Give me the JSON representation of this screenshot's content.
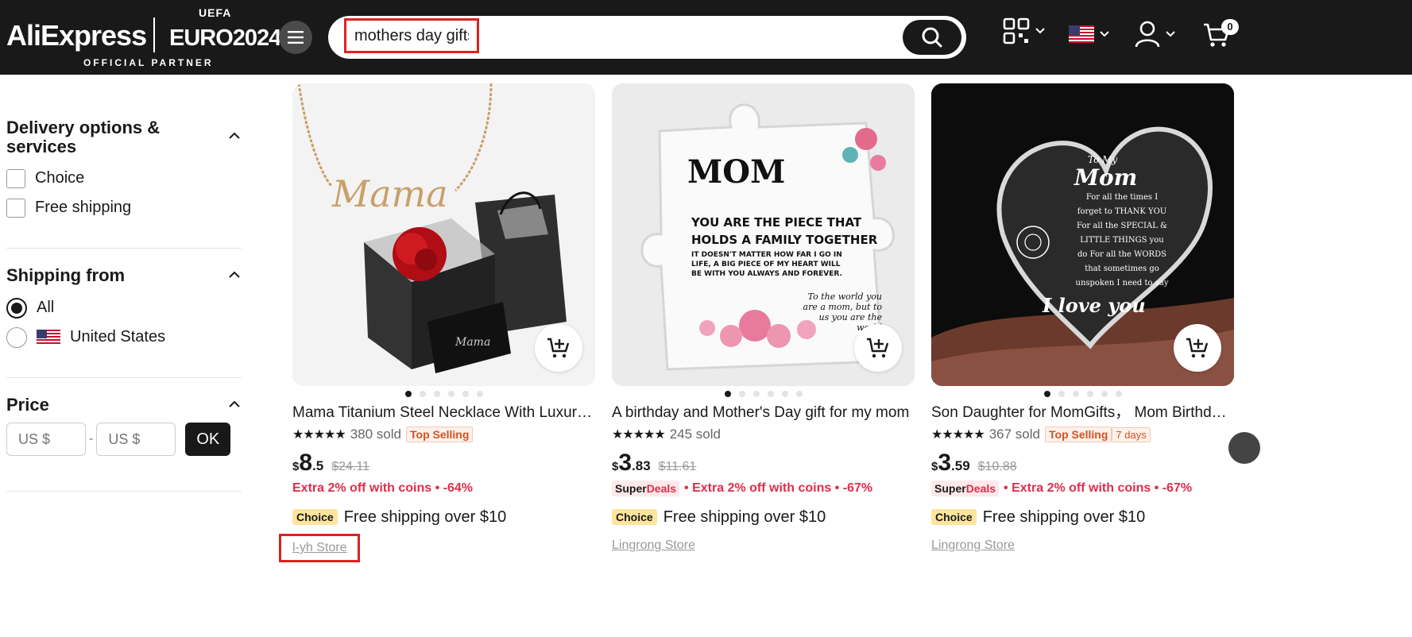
{
  "header": {
    "brand": "AliExpress",
    "partner_top": "UEFA",
    "partner_name": "EURO2024",
    "partner_tag": "OFFICIAL PARTNER",
    "search_value": "mothers day gifts",
    "cart_count": "0",
    "icons": [
      "menu-icon",
      "search-icon",
      "qr-code-icon",
      "us-flag-icon",
      "user-icon",
      "cart-icon"
    ]
  },
  "sidebar": {
    "delivery": {
      "title": "Delivery options & services",
      "options": [
        "Choice",
        "Free shipping"
      ]
    },
    "shipping_from": {
      "title": "Shipping from",
      "options": [
        "All",
        "United States"
      ],
      "selected": "All"
    },
    "price": {
      "title": "Price",
      "min_placeholder": "US $",
      "max_placeholder": "US $",
      "separator": "-",
      "ok_label": "OK"
    }
  },
  "products": [
    {
      "title": "Mama Titanium Steel Necklace With Luxury Rose Gift Box",
      "stars": "★★★★★",
      "sold": "380 sold",
      "tag": "Top Selling",
      "tag2": "",
      "currency": "$",
      "price_int": "8",
      "price_dec": ".5",
      "old_price": "$24.11",
      "superdeals": false,
      "extra": "Extra 2% off with coins • -64%",
      "choice": "Choice",
      "shipping": "Free shipping over $10",
      "store": "l-yh Store"
    },
    {
      "title": "A birthday and Mother's Day gift for my mom",
      "stars": "★★★★★",
      "sold": "245 sold",
      "tag": "",
      "tag2": "",
      "currency": "$",
      "price_int": "3",
      "price_dec": ".83",
      "old_price": "$11.61",
      "superdeals": true,
      "extra": "• Extra 2% off with coins • -67%",
      "choice": "Choice",
      "shipping": "Free shipping over $10",
      "store": "Lingrong Store"
    },
    {
      "title": "Son Daughter for MomGifts， Mom Birthday Gifts",
      "stars": "★★★★★",
      "sold": "367 sold",
      "tag": "Top Selling",
      "tag2": "7 days",
      "currency": "$",
      "price_int": "3",
      "price_dec": ".59",
      "old_price": "$10.88",
      "superdeals": true,
      "extra": "• Extra 2% off with coins • -67%",
      "choice": "Choice",
      "shipping": "Free shipping over $10",
      "store": "Lingrong Store"
    }
  ],
  "superdeals_label": {
    "a": "Super",
    "b": "Deals"
  },
  "image_text": {
    "p1_necklace": "Mama",
    "p2_title": "MOM",
    "p2_line1": "YOU ARE THE PIECE THAT",
    "p2_line2": "HOLDS A FAMILY TOGETHER",
    "p2_body": "IT DOESN'T MATTER HOW FAR I GO IN LIFE, A BIG PIECE OF MY HEART WILL BE WITH YOU ALWAYS AND FOREVER.",
    "p2_script": "To the world you are a mom, but to us you are the world",
    "p3_to": "To My",
    "p3_mom": "Mom",
    "p3_body": "For all the times I forget to THANK YOU For all the SPECIAL & LITTLE THINGS you do For all the WORDS that sometimes go unspoken I need to say",
    "p3_love": "I love you"
  },
  "colors": {
    "header_bg": "#191919",
    "accent_red": "#e02d4b",
    "highlight_box": "#e02020",
    "choice_bg": "#fde59c"
  }
}
